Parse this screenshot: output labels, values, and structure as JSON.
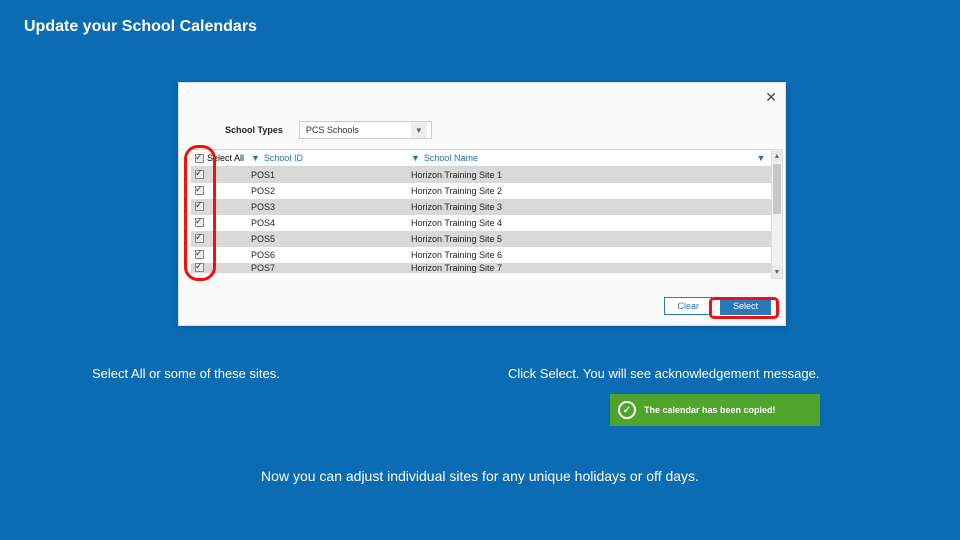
{
  "title": "Update your School Calendars",
  "panel": {
    "close": "✕",
    "school_types_label": "School Types",
    "dropdown_value": "PCS Schools",
    "columns": {
      "select_all": "Select All",
      "school_id": "School ID",
      "school_name": "School Name"
    },
    "rows": [
      {
        "id": "POS1",
        "name": "Horizon Training Site 1"
      },
      {
        "id": "POS2",
        "name": "Horizon Training Site 2"
      },
      {
        "id": "POS3",
        "name": "Horizon Training Site 3"
      },
      {
        "id": "POS4",
        "name": "Horizon Training Site 4"
      },
      {
        "id": "POS5",
        "name": "Horizon Training Site 5"
      },
      {
        "id": "POS6",
        "name": "Horizon Training Site 6"
      },
      {
        "id": "POS7",
        "name": "Horizon Training Site 7"
      }
    ],
    "buttons": {
      "clear": "Clear",
      "select": "Select"
    }
  },
  "tips": {
    "left": "Select All or some of these sites.",
    "right": "Click Select. You will see acknowledgement message."
  },
  "toast": "The calendar has been copied!",
  "bottom": "Now you can adjust individual sites for any unique holidays or off days."
}
